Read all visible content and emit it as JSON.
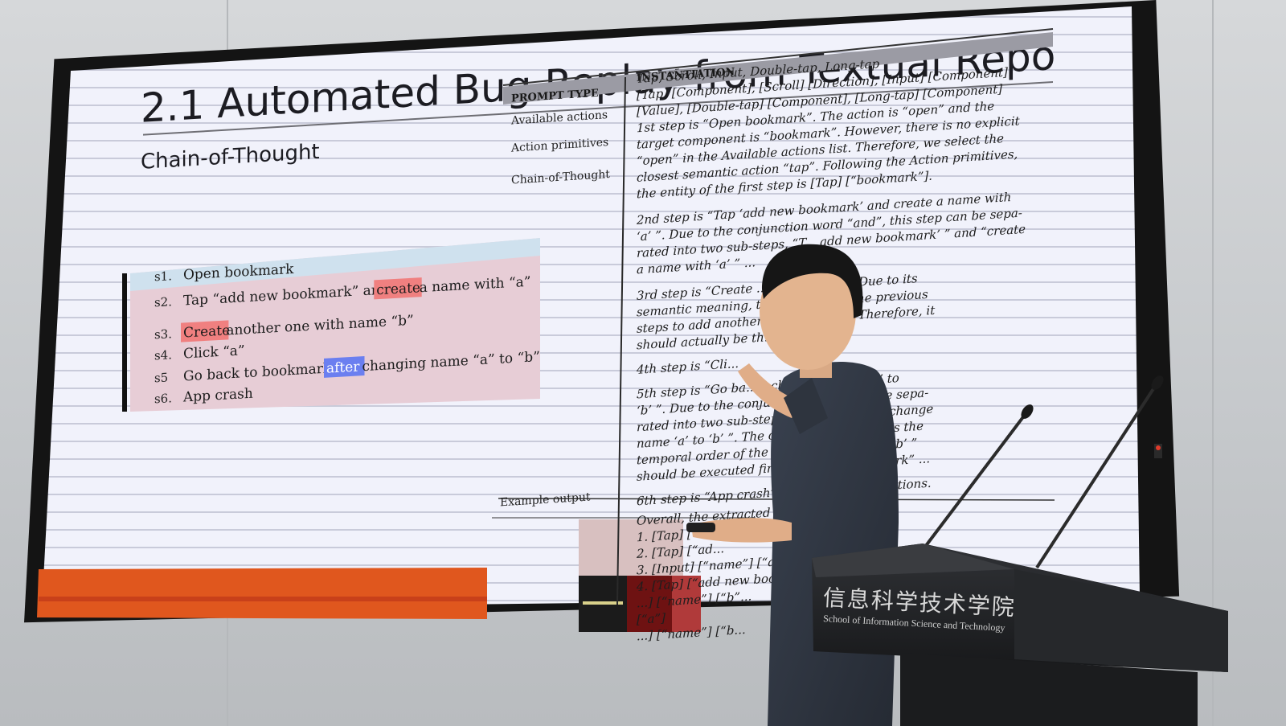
{
  "slide": {
    "title": "2.1 Automated Bug Replay from Textual Repo",
    "subtitle": "Chain-of-Thought",
    "steps": [
      {
        "num": "s1.",
        "parts": [
          {
            "t": "Open bookmark",
            "h": ""
          }
        ]
      },
      {
        "num": "s2.",
        "parts": [
          {
            "t": "Tap “add new bookmark” and ",
            "h": ""
          },
          {
            "t": "create",
            "h": "red"
          },
          {
            "t": " a name with “a”",
            "h": ""
          }
        ]
      },
      {
        "num": "s3.",
        "parts": [
          {
            "t": "Create",
            "h": "red"
          },
          {
            "t": " another one with name “b”",
            "h": ""
          }
        ]
      },
      {
        "num": "s4.",
        "parts": [
          {
            "t": "Click “a”",
            "h": ""
          }
        ]
      },
      {
        "num": "s5",
        "parts": [
          {
            "t": "Go back to bookmark ",
            "h": ""
          },
          {
            "t": "after",
            "h": "blue"
          },
          {
            "t": " changing name “a” to “b”",
            "h": ""
          }
        ]
      },
      {
        "num": "s6.",
        "parts": [
          {
            "t": "App crash",
            "h": ""
          }
        ]
      }
    ],
    "table": {
      "header_col1": "PROMPT TYPE",
      "header_col2": "INSTANTIATION",
      "row_labels": [
        "Available actions",
        "Action primitives",
        "Chain-of-Thought",
        "Example output"
      ],
      "lines": [
        "Tap, Scroll, Input, Double-tap, Long-tap",
        "[Tap] [Component], [Scroll] [Direction], [Input] [Component]",
        "[Value], [Double-tap] [Component], [Long-tap] [Component]",
        "1st step is “Open bookmark”. The action is “open” and the",
        "target component is “bookmark”. However, there is no explicit",
        "“open” in the Available actions list. Therefore, we select the",
        "closest semantic action “tap”. Following the Action primitives,",
        "the entity of the first step is [Tap] [“bookmark”].",
        "2nd step is “Tap ‘add new bookmark’ and create a name with",
        "‘a’ ”. Due to the conjunction word “and”, this step can be sepa-",
        "rated into two sub-steps, “T... add new bookmark’ ” and “create",
        "a name with ‘a’ ” ...",
        "3rd step is “Create ... th name ‘b’ ”. Due to its",
        "semantic meaning, t... nt to repeat the previous",
        "steps to add another ... h name “b”. Therefore, it",
        "should actually be th...",
        "4th step is “Cli...",
        "5th step is “Go ba... r changing name ‘a’ to",
        "‘b’ ”. Due to the conju... ” this step can be sepa-",
        "rated into two sub-steps, ... kmark” and “change",
        "name ‘a’ to ‘b’ ”. The co... after” also alters the",
        "temporal order of the su... ge name ‘a’ to ‘b’ ”",
        "should be executed first, ... ack to bookmark” ...",
        "6th step is “App crash”. I... have any operations.",
        "Overall, the extracted S2...",
        "1. [Tap] [“...",
        "2. [Tap] [“ad...",
        "3. [Input] [“name”] [“a...",
        "4. [Tap] [“add new book...",
        "...] [“name”] [“b”...",
        "[“a”]",
        "...] [“name”] [“b..."
      ]
    }
  },
  "podium": {
    "chinese": "信息科学技术学院",
    "english": "School of Information Science and Technology"
  },
  "colors": {
    "screen_bg": "#eef0fa",
    "red_highlight": "#f08080",
    "blue_highlight": "#6b7ff0",
    "table_header": "#b8b8c0",
    "orange_bar": "#e0571e",
    "podium": "#222428"
  }
}
